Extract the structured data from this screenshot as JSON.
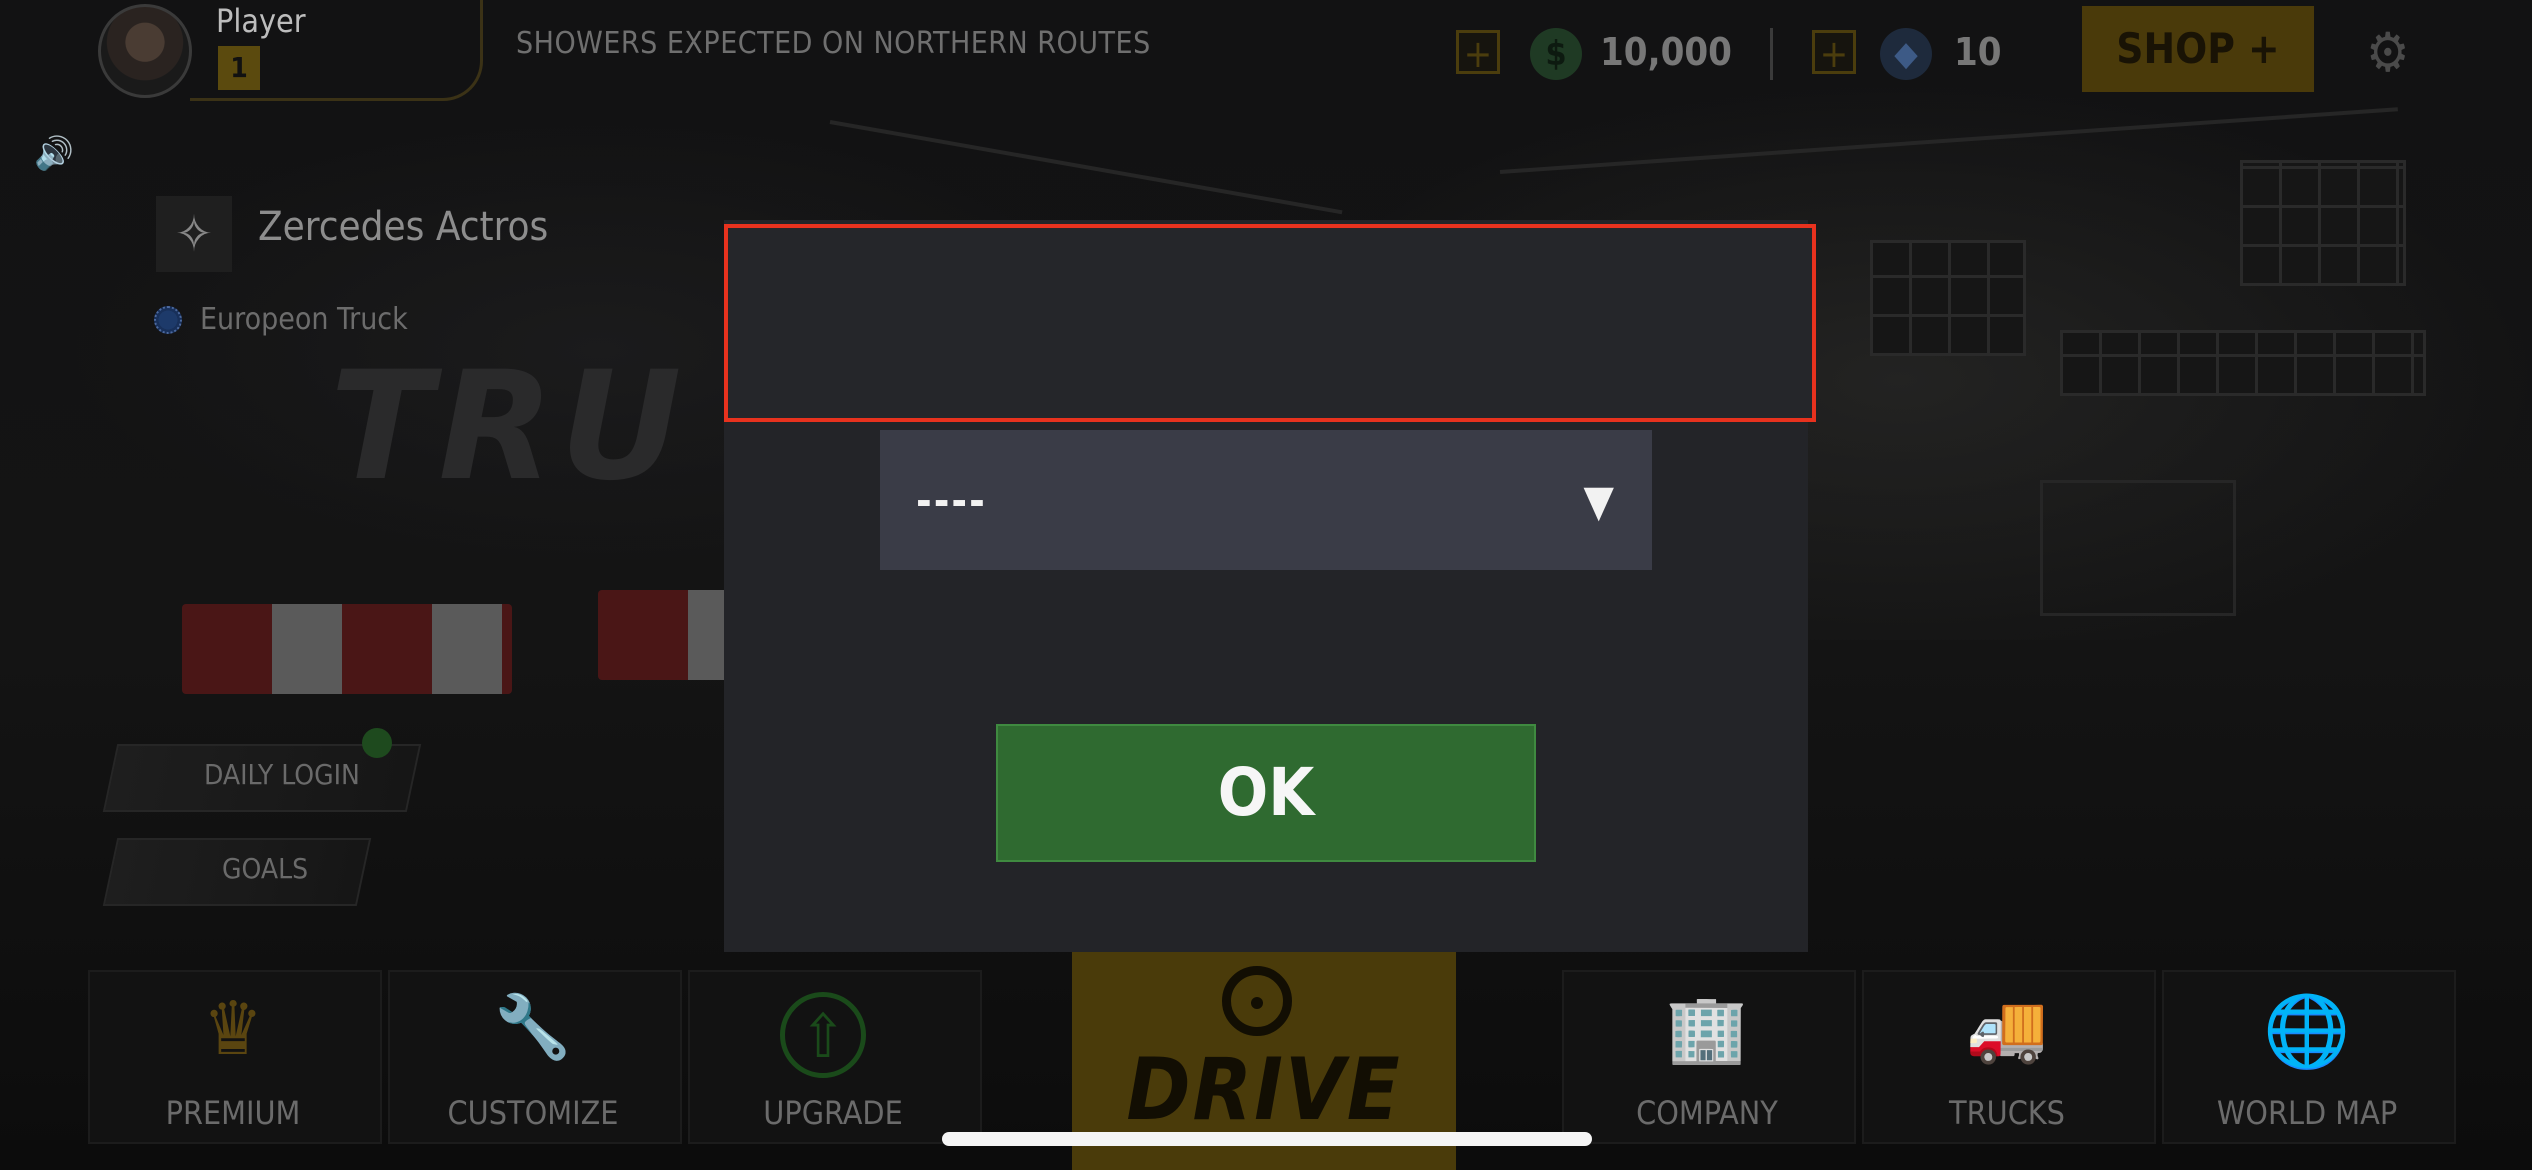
{
  "player": {
    "name": "Player",
    "level": "1",
    "avatar_icon": "player-avatar"
  },
  "news_ticker": "SHOWERS EXPECTED ON NORTHERN ROUTES",
  "currency": {
    "cash_value": "10,000",
    "cash_symbol": "$",
    "gems_value": "10",
    "gems_symbol": "◆",
    "add_symbol": "+"
  },
  "shop": {
    "label": "SHOP +"
  },
  "settings_icon": "⚙",
  "sound_icon": "🔊",
  "truck": {
    "brand_icon": "✧",
    "name": "Zercedes Actros",
    "class": "Europeon Truck"
  },
  "side_menu": {
    "daily_login": "DAILY LOGIN",
    "goals": "GOALS"
  },
  "bottom_nav": {
    "premium": {
      "label": "PREMIUM",
      "icon": "♛"
    },
    "customize": {
      "label": "CUSTOMIZE",
      "icon": "🔧"
    },
    "upgrade": {
      "label": "UPGRADE",
      "icon": "⇧"
    },
    "drive": {
      "label": "DRIVE"
    },
    "company": {
      "label": "COMPANY",
      "icon": "🏢"
    },
    "trucks": {
      "label": "TRUCKS",
      "icon": "🚚"
    },
    "world_map": {
      "label": "WORLD MAP",
      "icon": "🌐"
    }
  },
  "dialog": {
    "dropdown_value": "----",
    "dropdown_arrow": "▼",
    "ok_label": "OK"
  },
  "background_logo": "TRU",
  "colors": {
    "accent_gold": "#4a3a0a",
    "ok_green": "#2f6a30",
    "highlight_red": "#e8321e"
  }
}
